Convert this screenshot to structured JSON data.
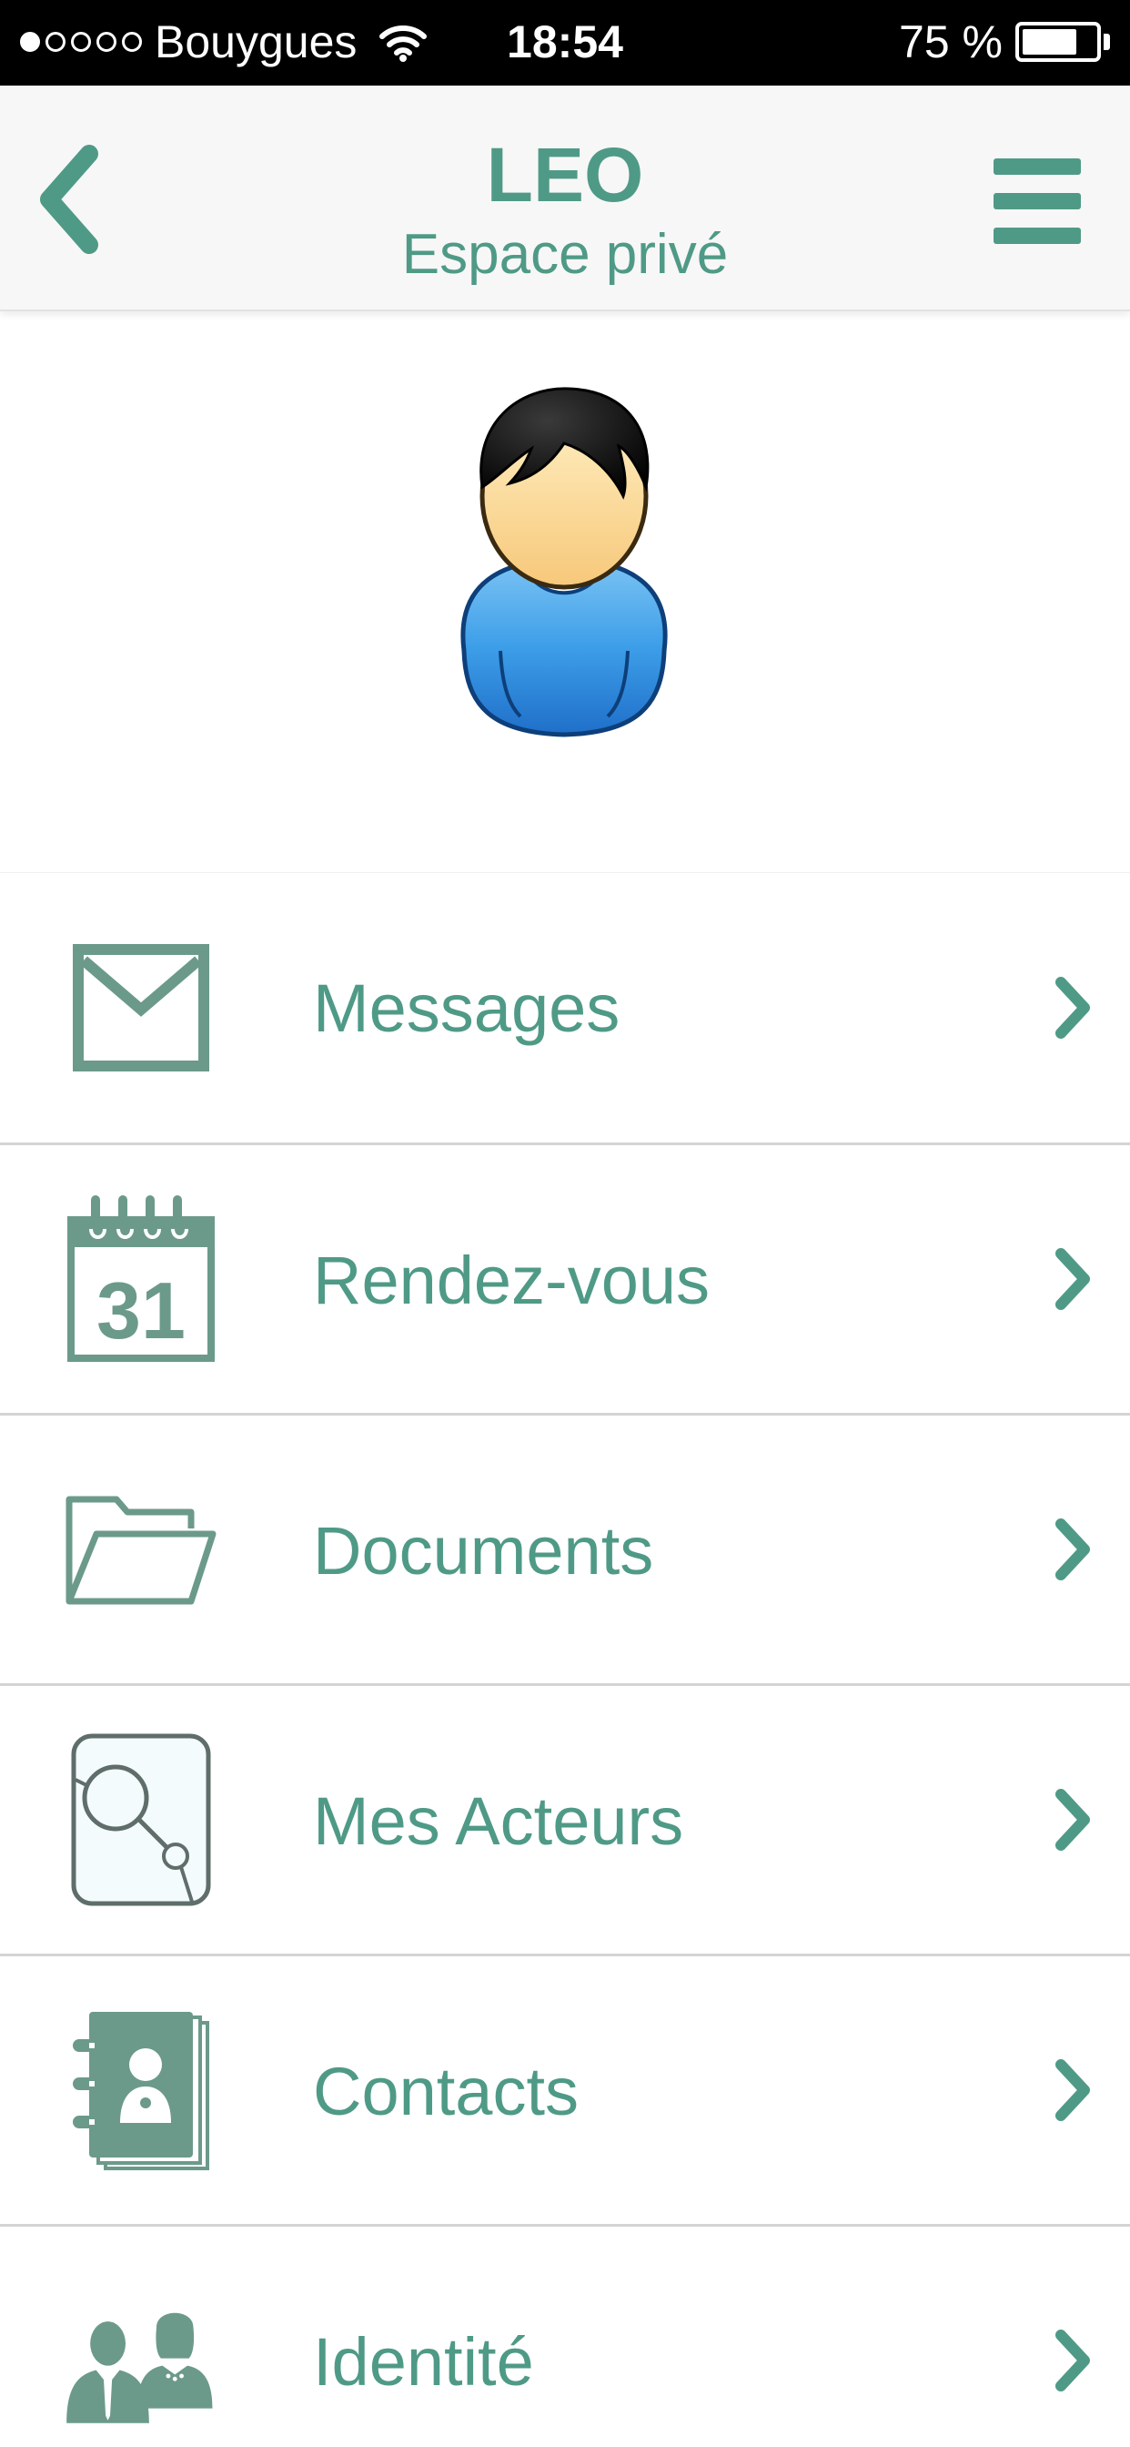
{
  "status_bar": {
    "carrier": "Bouygues",
    "signal_dots_filled": 1,
    "signal_dots_total": 5,
    "time": "18:54",
    "battery_percent_label": "75 %",
    "battery_level": 0.75
  },
  "header": {
    "title": "LEO",
    "subtitle": "Espace privé",
    "back_icon": "chevron-left-icon",
    "menu_icon": "hamburger-menu-icon"
  },
  "menu": {
    "items": [
      {
        "label": "Messages",
        "icon": "envelope-icon"
      },
      {
        "label": "Rendez-vous",
        "icon": "calendar-icon",
        "icon_text": "31"
      },
      {
        "label": "Documents",
        "icon": "folder-icon"
      },
      {
        "label": "Mes Acteurs",
        "icon": "search-network-icon"
      },
      {
        "label": "Contacts",
        "icon": "address-book-icon"
      },
      {
        "label": "Identité",
        "icon": "people-icon"
      }
    ]
  },
  "colors": {
    "accent": "#4f9a86",
    "icon": "#6c9a8a",
    "status_bar": "#000000",
    "divider": "#d4d4d4"
  }
}
